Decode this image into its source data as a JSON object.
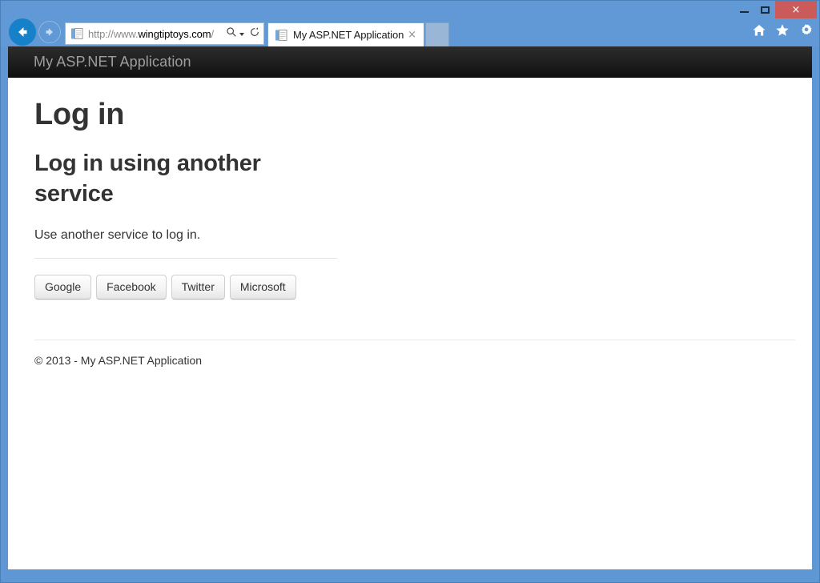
{
  "browser": {
    "window_controls": {
      "minimize_label": "Minimize",
      "maximize_label": "Maximize",
      "close_label": "×"
    },
    "toolbar_icons": [
      {
        "name": "home-icon",
        "label": "Home"
      },
      {
        "name": "favorites-icon",
        "label": "Favorites"
      },
      {
        "name": "settings-icon",
        "label": "Tools"
      }
    ],
    "navigation": {
      "back_label": "Back",
      "forward_label": "Forward"
    },
    "address_bar": {
      "url_scheme": "http://www.",
      "url_host": "wingtiptoys.com",
      "url_path": "/",
      "full_url": "http://www.wingtiptoys.com/",
      "search_icon": "search-icon",
      "refresh_icon": "refresh-icon"
    },
    "tabs": [
      {
        "title": "My ASP.NET Application",
        "close_label": "×",
        "active": true
      }
    ],
    "new_tab_label": "New tab"
  },
  "page": {
    "navbar": {
      "brand": "My ASP.NET Application"
    },
    "title": "Log in",
    "section": {
      "heading": "Log in using another service",
      "paragraph": "Use another service to log in."
    },
    "providers": [
      {
        "label": "Google"
      },
      {
        "label": "Facebook"
      },
      {
        "label": "Twitter"
      },
      {
        "label": "Microsoft"
      }
    ],
    "footer": {
      "text": "© 2013 - My ASP.NET Application"
    }
  },
  "colors": {
    "chrome_blue": "#6099d6",
    "close_red": "#cb5a5a",
    "back_button_blue": "#1680c8",
    "navbar_dark": "#222222",
    "text_dark": "#333333",
    "brand_gray": "#9d9d9d"
  }
}
